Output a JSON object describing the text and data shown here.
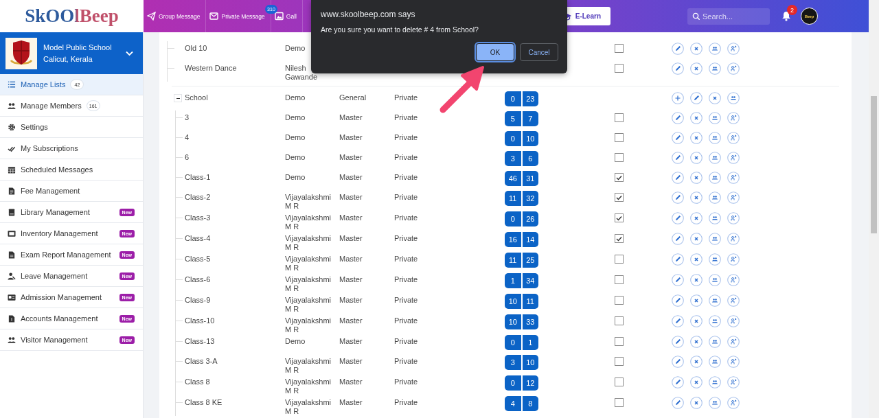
{
  "header": {
    "logo": "SkOOlBeep",
    "nav": [
      {
        "label": "Group Message"
      },
      {
        "label": "Private Message",
        "count": "310"
      },
      {
        "label": "Gall"
      }
    ],
    "elearn": "E-Learn",
    "search": {
      "placeholder": "Search..."
    },
    "notifications": "2",
    "avatar": "Beep"
  },
  "sidebar": {
    "school": {
      "name": "Model Public School",
      "location": "Calicut, Kerala"
    },
    "items": [
      {
        "label": "Manage Lists",
        "count": "42",
        "selected": true
      },
      {
        "label": "Manage Members",
        "count": "161",
        "selected": false
      },
      {
        "label": "Settings",
        "selected": false
      },
      {
        "label": "My Subscriptions",
        "selected": false
      },
      {
        "label": "Scheduled Messages",
        "selected": false
      },
      {
        "label": "Fee Management",
        "selected": false
      },
      {
        "label": "Library Management",
        "badge": "New",
        "selected": false
      },
      {
        "label": "Inventory Management",
        "badge": "New",
        "selected": false
      },
      {
        "label": "Exam Report Management",
        "badge": "New",
        "selected": false
      },
      {
        "label": "Leave Management",
        "badge": "New",
        "selected": false
      },
      {
        "label": "Admission Management",
        "badge": "New",
        "selected": false
      },
      {
        "label": "Accounts Management",
        "badge": "New",
        "selected": false
      },
      {
        "label": "Visitor Management",
        "badge": "New",
        "selected": false
      }
    ]
  },
  "table": {
    "rows": [
      {
        "kind": "list",
        "name": "Old 10",
        "owner": "Demo",
        "checked": false
      },
      {
        "kind": "list",
        "name": "Western Dance",
        "owner": "Nilesh Gawande",
        "checked": false
      },
      {
        "kind": "group",
        "name": "School",
        "owner": "Demo",
        "type": "General",
        "privacy": "Private",
        "counts": [
          "0",
          "23"
        ],
        "expanded": true,
        "children": [
          {
            "kind": "list",
            "name": "3",
            "owner": "Demo",
            "type": "Master",
            "privacy": "Private",
            "counts": [
              "5",
              "7"
            ],
            "checked": false
          },
          {
            "kind": "list",
            "name": "4",
            "owner": "Demo",
            "type": "Master",
            "privacy": "Private",
            "counts": [
              "0",
              "10"
            ],
            "checked": false
          },
          {
            "kind": "list",
            "name": "6",
            "owner": "Demo",
            "type": "Master",
            "privacy": "Private",
            "counts": [
              "3",
              "6"
            ],
            "checked": false
          },
          {
            "kind": "list",
            "name": "Class-1",
            "owner": "Demo",
            "type": "Master",
            "privacy": "Private",
            "counts": [
              "46",
              "31"
            ],
            "checked": true
          },
          {
            "kind": "list",
            "name": "Class-2",
            "owner": "Vijayalakshmi M R",
            "type": "Master",
            "privacy": "Private",
            "counts": [
              "11",
              "32"
            ],
            "checked": true
          },
          {
            "kind": "list",
            "name": "Class-3",
            "owner": "Vijayalakshmi M R",
            "type": "Master",
            "privacy": "Private",
            "counts": [
              "0",
              "26"
            ],
            "checked": true
          },
          {
            "kind": "list",
            "name": "Class-4",
            "owner": "Vijayalakshmi M R",
            "type": "Master",
            "privacy": "Private",
            "counts": [
              "16",
              "14"
            ],
            "checked": true
          },
          {
            "kind": "list",
            "name": "Class-5",
            "owner": "Vijayalakshmi M R",
            "type": "Master",
            "privacy": "Private",
            "counts": [
              "11",
              "25"
            ],
            "checked": false
          },
          {
            "kind": "list",
            "name": "Class-6",
            "owner": "Vijayalakshmi M R",
            "type": "Master",
            "privacy": "Private",
            "counts": [
              "1",
              "34"
            ],
            "checked": false
          },
          {
            "kind": "list",
            "name": "Class-9",
            "owner": "Vijayalakshmi M R",
            "type": "Master",
            "privacy": "Private",
            "counts": [
              "10",
              "11"
            ],
            "checked": false
          },
          {
            "kind": "list",
            "name": "Class-10",
            "owner": "Vijayalakshmi M R",
            "type": "Master",
            "privacy": "Private",
            "counts": [
              "10",
              "33"
            ],
            "checked": false
          },
          {
            "kind": "list",
            "name": "Class-13",
            "owner": "Demo",
            "type": "Master",
            "privacy": "Private",
            "counts": [
              "0",
              "1"
            ],
            "checked": false
          },
          {
            "kind": "list",
            "name": "Class 3-A",
            "owner": "Vijayalakshmi M R",
            "type": "Master",
            "privacy": "Private",
            "counts": [
              "3",
              "10"
            ],
            "checked": false
          },
          {
            "kind": "list",
            "name": "Class 8",
            "owner": "Vijayalakshmi M R",
            "type": "Master",
            "privacy": "Private",
            "counts": [
              "0",
              "12"
            ],
            "checked": false
          },
          {
            "kind": "list",
            "name": "Class 8 KE",
            "owner": "Vijayalakshmi M R",
            "type": "Master",
            "privacy": "Private",
            "counts": [
              "4",
              "8"
            ],
            "checked": false
          }
        ]
      }
    ]
  },
  "dialog": {
    "title": "www.skoolbeep.com says",
    "message": "Are you sure you want to delete # 4 from School?",
    "buttons": [
      {
        "label": "OK",
        "focused": true
      },
      {
        "label": "Cancel",
        "focused": false
      }
    ]
  }
}
